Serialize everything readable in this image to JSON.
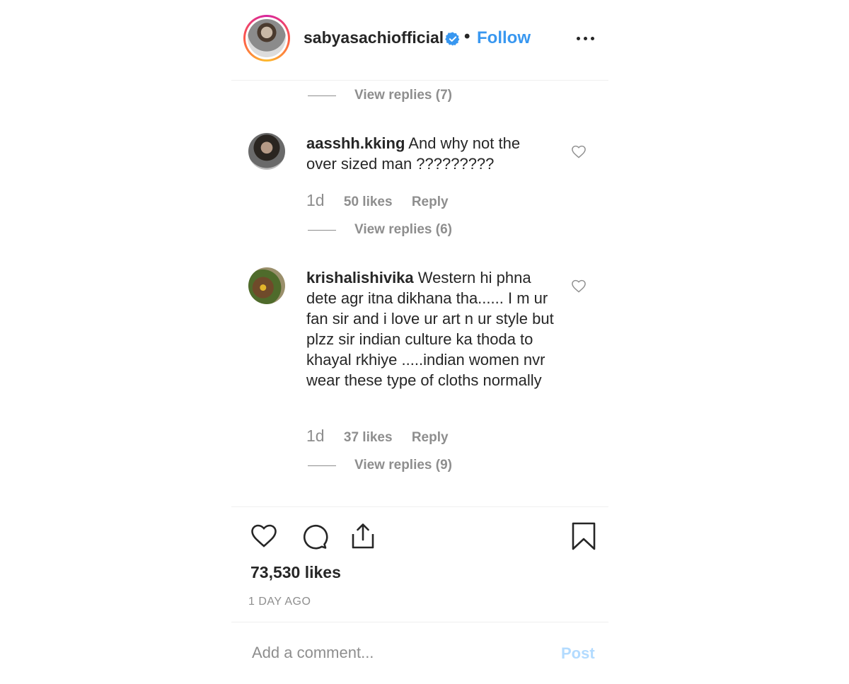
{
  "header": {
    "username": "sabyasachiofficial",
    "separator": "•",
    "follow_label": "Follow",
    "more_icon": "more-dots-icon",
    "verified_icon": "verified-badge-icon"
  },
  "top_view_replies": "View replies (7)",
  "comments": [
    {
      "username": "aasshh.kking",
      "text": "And why not the over sized man ?????????",
      "time": "1d",
      "likes": "50 likes",
      "reply_label": "Reply",
      "view_replies": "View replies (6)"
    },
    {
      "username": "krishalishivika",
      "text": "Western hi phna dete agr itna dikhana tha...... I m ur fan sir and i love ur art n ur style but plzz sir indian culture ka thoda to khayal rkhiye .....indian women nvr wear these type of cloths normally",
      "time": "1d",
      "likes": "37 likes",
      "reply_label": "Reply",
      "view_replies": "View replies (9)"
    }
  ],
  "actions": {
    "like_icon": "heart-icon",
    "comment_icon": "comment-icon",
    "share_icon": "share-icon",
    "save_icon": "bookmark-icon"
  },
  "post": {
    "likes_total": "73,530 likes",
    "time_ago": "1 DAY AGO"
  },
  "comment_box": {
    "placeholder": "Add a comment...",
    "post_label": "Post"
  },
  "colors": {
    "accent": "#3897f0",
    "muted": "#8e8e8e",
    "post_disabled": "#b3dbff",
    "text": "#262626"
  }
}
